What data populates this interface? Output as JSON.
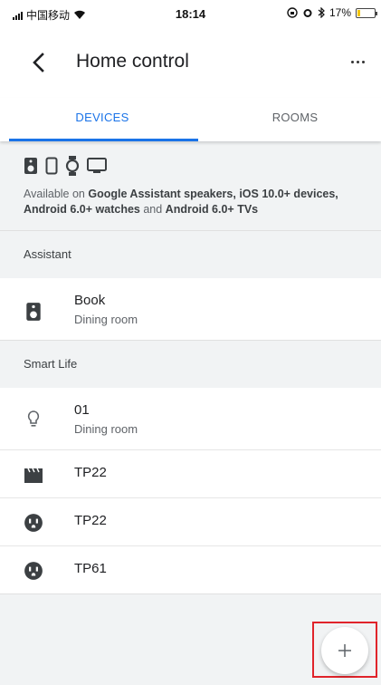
{
  "status_bar": {
    "carrier": "中国移动",
    "time": "18:14",
    "battery_percent": "17%",
    "battery_level": 0.17
  },
  "header": {
    "title": "Home control",
    "back_icon": "back-arrow-icon",
    "more_icon": "more-horizontal-icon"
  },
  "tabs": [
    {
      "label": "DEVICES",
      "selected": true
    },
    {
      "label": "ROOMS",
      "selected": false
    }
  ],
  "availability": {
    "icons": [
      "speaker-icon",
      "phone-icon",
      "watch-icon",
      "tv-icon"
    ],
    "prefix": "Available on ",
    "part1": "Google Assistant speakers, iOS 10.0+ devices,",
    "part2": "Android 6.0+ watches",
    "connector": " and ",
    "part3": "Android 6.0+ TVs"
  },
  "sections": [
    {
      "title": "Assistant",
      "devices": [
        {
          "name": "Book",
          "room": "Dining room",
          "icon": "speaker-icon"
        }
      ]
    },
    {
      "title": "Smart Life",
      "devices": [
        {
          "name": "01",
          "room": "Dining room",
          "icon": "bulb-icon"
        },
        {
          "name": "TP22",
          "room": "",
          "icon": "clapperboard-icon"
        },
        {
          "name": "TP22",
          "room": "",
          "icon": "outlet-icon"
        },
        {
          "name": "TP61",
          "room": "",
          "icon": "outlet-icon"
        }
      ]
    }
  ],
  "fab": {
    "icon": "plus-icon"
  },
  "colors": {
    "accent": "#1a73e8",
    "highlight": "#e0242b",
    "background": "#f1f3f4"
  }
}
